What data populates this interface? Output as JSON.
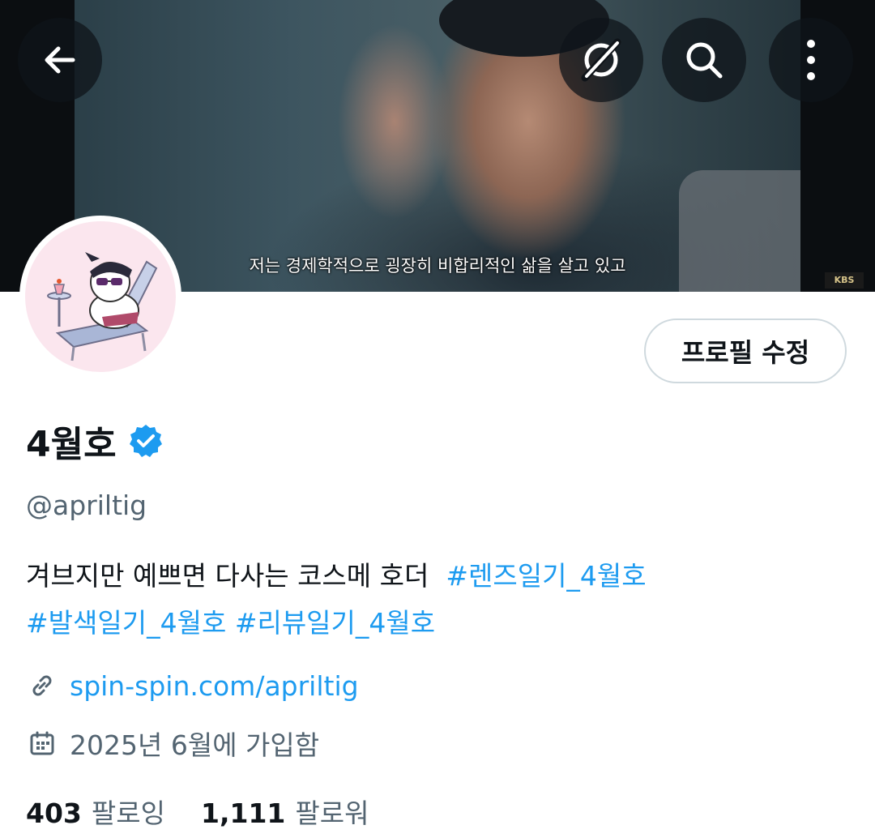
{
  "banner": {
    "subtitle": "저는 경제학적으로 굉장히 비합리적인 삶을 살고 있고",
    "broadcaster": "KBS"
  },
  "topbar": {
    "back_icon": "arrow-left-icon",
    "grok_icon": "grok-icon",
    "search_icon": "search-icon",
    "more_icon": "more-vertical-icon"
  },
  "profile": {
    "display_name": "4월호",
    "verified": true,
    "handle": "@apriltig",
    "edit_button": "프로필 수정",
    "bio_text": "겨브지만 예쁘면 다사는 코스메 호더",
    "bio_tags": [
      "#렌즈일기_4월호",
      "#발색일기_4월호",
      "#리뷰일기_4월호"
    ],
    "website": "spin-spin.com/apriltig",
    "joined": "2025년 6월에 가입함"
  },
  "stats": {
    "following_count": "403",
    "following_label": "팔로잉",
    "followers_count": "1,111",
    "followers_label": "팔로워"
  },
  "colors": {
    "accent": "#1d9bf0",
    "secondary_text": "#536471",
    "primary_text": "#0f1419",
    "border": "#cfd9de"
  }
}
